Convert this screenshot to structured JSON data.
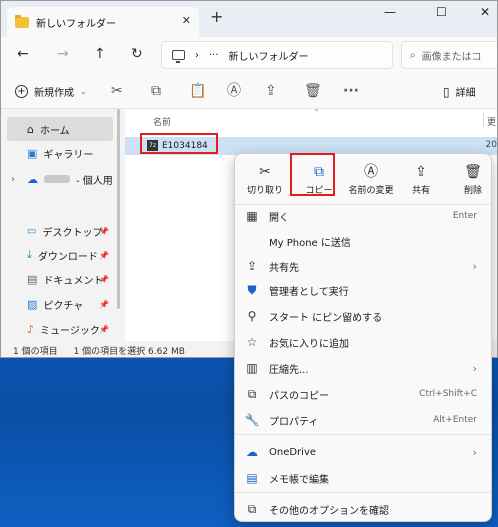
{
  "window": {
    "tab_title": "新しいフォルダー",
    "tab_close": "✕",
    "new_tab": "+",
    "minimize": "—",
    "maximize": "☐",
    "close": "✕"
  },
  "addressbar": {
    "breadcrumb_chevron": "›",
    "more": "···",
    "current_folder": "新しいフォルダー",
    "search_placeholder": "画像またはコ"
  },
  "toolbar": {
    "new_label": "新規作成",
    "details_label": "詳細",
    "more": "···"
  },
  "navigation": {
    "items": [
      {
        "label": "ホーム",
        "icon": "home-icon"
      },
      {
        "label": "ギャラリー",
        "icon": "gallery-icon"
      },
      {
        "label": "- 個人用",
        "icon": "onedrive-icon"
      },
      {
        "label": "デスクトップ",
        "icon": "desktop-icon"
      },
      {
        "label": "ダウンロード",
        "icon": "download-icon"
      },
      {
        "label": "ドキュメント",
        "icon": "document-icon"
      },
      {
        "label": "ピクチャ",
        "icon": "picture-icon"
      },
      {
        "label": "ミュージック",
        "icon": "music-icon"
      }
    ]
  },
  "filelist": {
    "column_name": "名前",
    "column_date": "更",
    "file_name": "E1034184",
    "file_date": "20",
    "zip_glyph": "7z"
  },
  "statusbar": {
    "count": "1 個の項目",
    "selected": "1 個の項目を選択  6.62 MB"
  },
  "context_menu": {
    "actions": [
      {
        "label": "切り取り",
        "icon": "scissors-icon"
      },
      {
        "label": "コピー",
        "icon": "copy-icon"
      },
      {
        "label": "名前の変更",
        "icon": "rename-icon"
      },
      {
        "label": "共有",
        "icon": "share-icon"
      },
      {
        "label": "削除",
        "icon": "trash-icon"
      }
    ],
    "items": [
      {
        "label": "開く",
        "shortcut": "Enter",
        "icon": "open-icon"
      },
      {
        "label": "My Phone に送信",
        "shortcut": "",
        "icon": "phone-icon"
      },
      {
        "label": "共有先",
        "shortcut": "",
        "icon": "share-to-icon",
        "submenu": true
      },
      {
        "label": "管理者として実行",
        "shortcut": "",
        "icon": "shield-icon"
      },
      {
        "label": "スタート にピン留めする",
        "shortcut": "",
        "icon": "pin-icon"
      },
      {
        "label": "お気に入りに追加",
        "shortcut": "",
        "icon": "star-icon"
      },
      {
        "label": "圧縮先...",
        "shortcut": "",
        "icon": "archive-icon",
        "submenu": true
      },
      {
        "label": "パスのコピー",
        "shortcut": "Ctrl+Shift+C",
        "icon": "path-copy-icon"
      },
      {
        "label": "プロパティ",
        "shortcut": "Alt+Enter",
        "icon": "wrench-icon"
      },
      {
        "label": "OneDrive",
        "shortcut": "",
        "icon": "onedrive-icon",
        "submenu": true
      },
      {
        "label": "メモ帳で編集",
        "shortcut": "",
        "icon": "notepad-icon"
      },
      {
        "label": "その他のオプションを確認",
        "shortcut": "",
        "icon": "more-options-icon"
      }
    ],
    "submenu_arrow": "›"
  },
  "colors": {
    "accent": "#1a64c8",
    "highlight_box": "#e02020",
    "selection": "#cde1f5",
    "desktop": "#0b55b0"
  }
}
